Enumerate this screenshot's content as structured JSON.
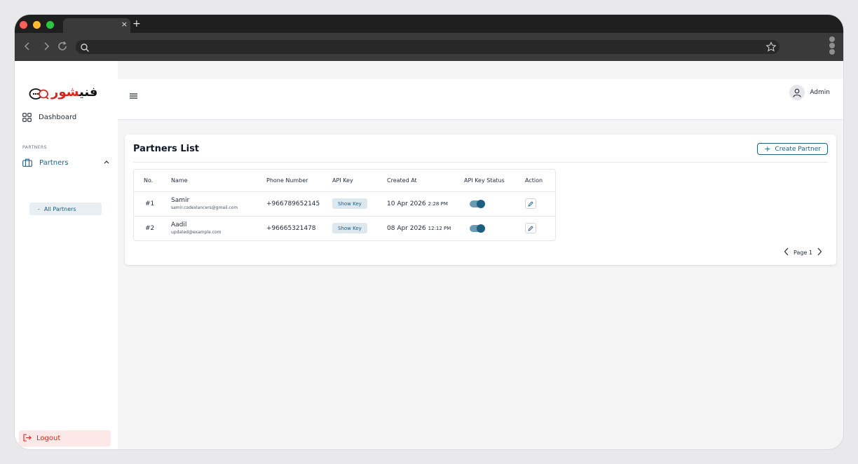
{
  "browser": {
    "tab_close": "×",
    "tab_new": "+"
  },
  "brand": {
    "logo_text_red": "شور",
    "logo_text_black": "فني",
    "colors": {
      "primary": "#1d5f80",
      "danger": "#d7261e"
    }
  },
  "sidebar": {
    "dashboard_label": "Dashboard",
    "section_label": "PARTNERS",
    "partners_label": "Partners",
    "sub_item_label": "All Partners",
    "sub_item_dash": "-",
    "logout_label": "Logout"
  },
  "topbar": {
    "user_name": "Admin"
  },
  "page": {
    "title": "Partners List",
    "create_button": "Create Partner",
    "create_plus": "+"
  },
  "table": {
    "headers": [
      "No.",
      "Name",
      "Phone Number",
      "API Key",
      "Created At",
      "API Key Status",
      "Action"
    ],
    "rows": [
      {
        "no": "#1",
        "name": "Samir",
        "email": "samir.codexlancers@gmail.com",
        "phone": "+966789652145",
        "api_key_button": "Show Key",
        "created_date": "10 Apr 2026",
        "created_time": "2:28 PM",
        "status_on": true
      },
      {
        "no": "#2",
        "name": "Aadil",
        "email": "updated@example.com",
        "phone": "+96665321478",
        "api_key_button": "Show Key",
        "created_date": "08 Apr 2026",
        "created_time": "12:12 PM",
        "status_on": true
      }
    ]
  },
  "pagination": {
    "label": "Page 1"
  }
}
